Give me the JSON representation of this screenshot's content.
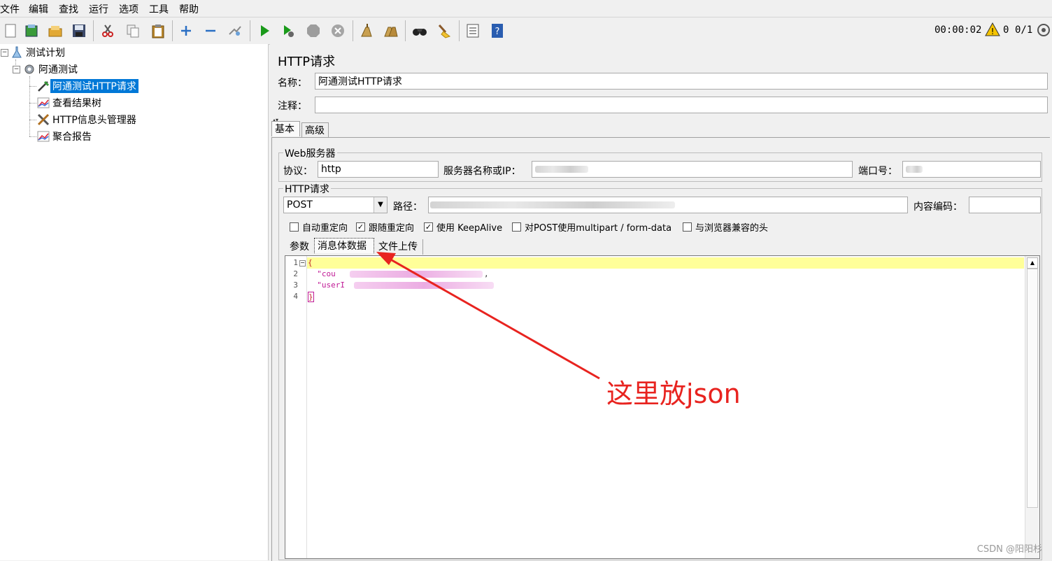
{
  "menu": [
    "文件",
    "编辑",
    "查找",
    "运行",
    "选项",
    "工具",
    "帮助"
  ],
  "toolbar": {
    "icons": [
      "new-icon",
      "template-icon",
      "open-icon",
      "save-icon",
      "cut-icon",
      "copy-icon",
      "paste-icon",
      "expand-icon",
      "collapse-icon",
      "toggle-icon",
      "start-icon",
      "start-no-pause-icon",
      "stop-icon",
      "shutdown-icon",
      "clear-icon",
      "clear-all-icon",
      "search-icon",
      "reset-search-icon",
      "function-helper-icon",
      "help-icon"
    ],
    "timer": "00:00:02",
    "warning_count": "0",
    "threads": "0/1"
  },
  "tree": {
    "items": [
      {
        "label": "测试计划"
      },
      {
        "label": "阿通测试"
      },
      {
        "label": "阿通测试HTTP请求"
      },
      {
        "label": "查看结果树"
      },
      {
        "label": "HTTP信息头管理器"
      },
      {
        "label": "聚合报告"
      }
    ]
  },
  "panel": {
    "title": "HTTP请求",
    "name_label": "名称：",
    "name_value": "阿通测试HTTP请求",
    "comment_label": "注释：",
    "comment_value": "",
    "tabs": [
      "基本",
      "高级"
    ],
    "web_server": {
      "group_title": "Web服务器",
      "protocol_label": "协议：",
      "protocol_value": "http",
      "server_label": "服务器名称或IP：",
      "port_label": "端口号："
    },
    "http_request": {
      "group_title": "HTTP请求",
      "method": "POST",
      "path_label": "路径：",
      "encoding_label": "内容编码：",
      "encoding_value": ""
    },
    "options": [
      {
        "label": "自动重定向",
        "checked": false
      },
      {
        "label": "跟随重定向",
        "checked": true
      },
      {
        "label": "使用 KeepAlive",
        "checked": true
      },
      {
        "label": "对POST使用multipart / form-data",
        "checked": false
      },
      {
        "label": "与浏览器兼容的头",
        "checked": false
      }
    ],
    "body_tabs": [
      "参数",
      "消息体数据",
      "文件上传"
    ],
    "editor": {
      "line_numbers": [
        "1",
        "2",
        "3",
        "4"
      ],
      "line1": "{",
      "line2_prefix": "  \"cou",
      "line3_prefix": "  \"userI",
      "line4": "}"
    }
  },
  "annotation": "这里放json",
  "watermark": "CSDN @阳阳杉"
}
